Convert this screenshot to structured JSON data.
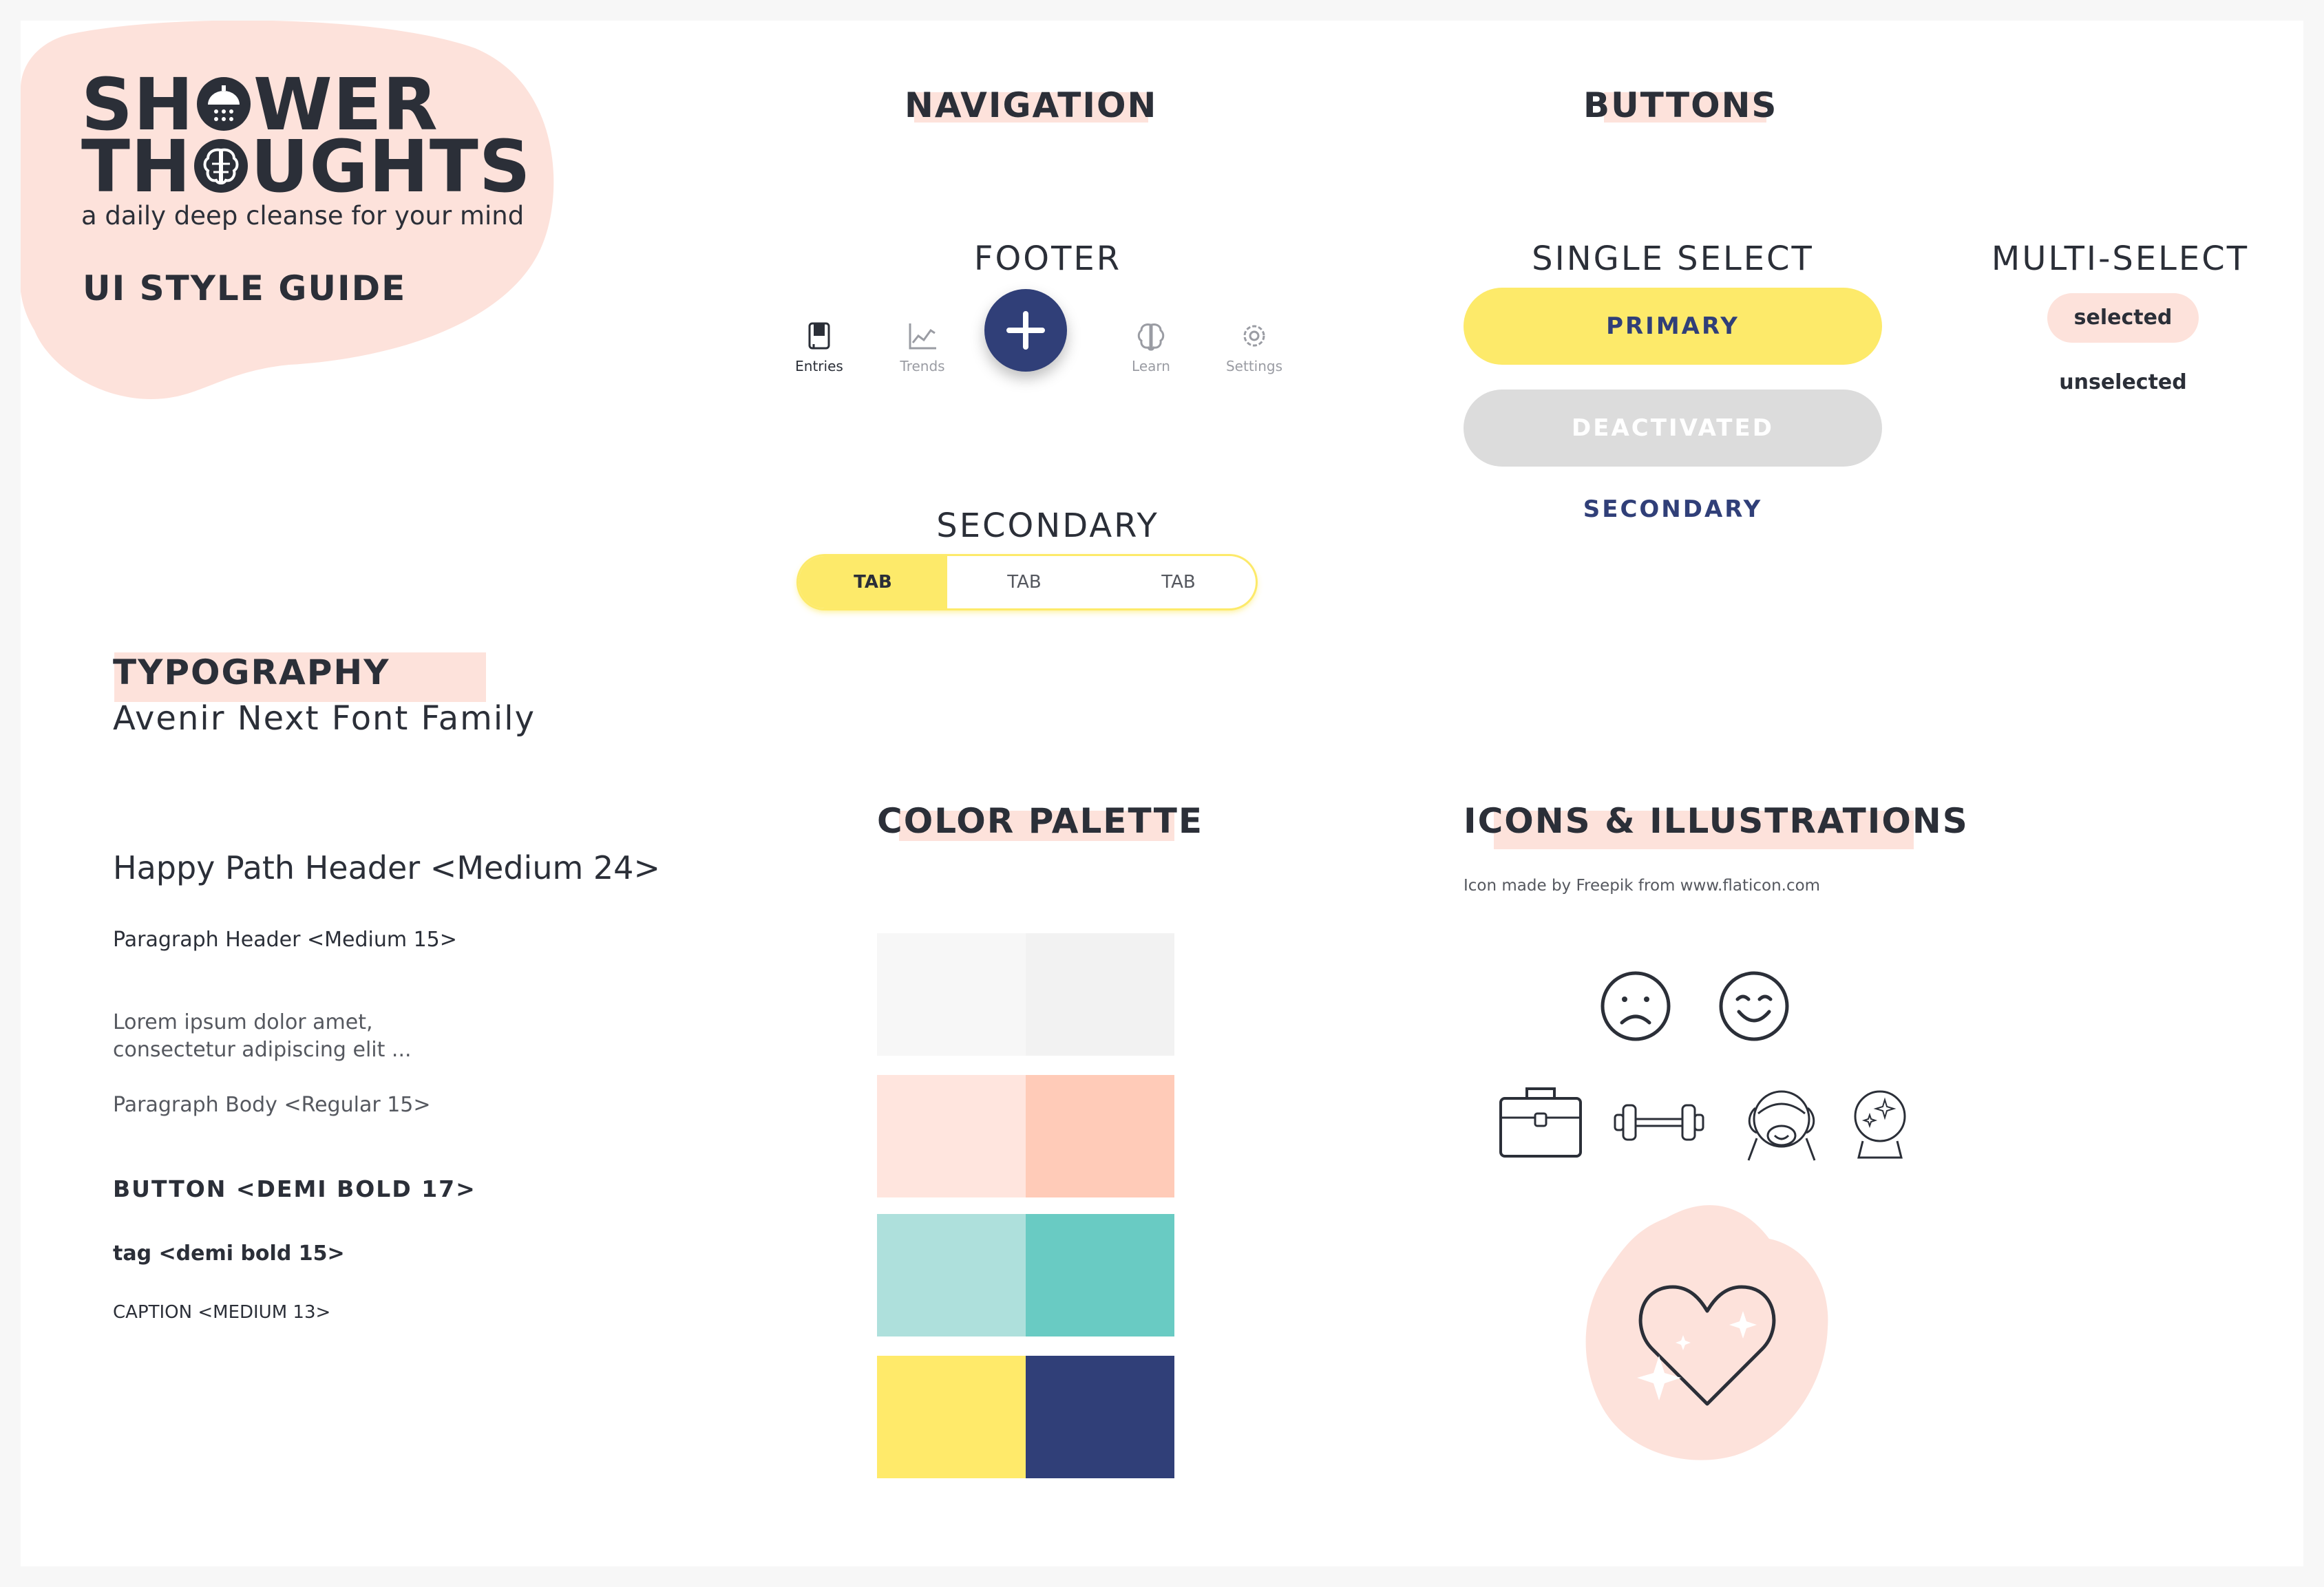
{
  "logo": {
    "line1": [
      "SH",
      "WER"
    ],
    "line2": [
      "TH",
      "UGHTS"
    ],
    "tagline": "a daily deep cleanse for your mind",
    "guide_title": "UI STYLE GUIDE",
    "blob_color": "#fde2db"
  },
  "navigation": {
    "heading": "NAVIGATION",
    "footer_heading": "FOOTER",
    "footer_items": [
      {
        "label": "Entries",
        "icon": "journal-icon",
        "active": true
      },
      {
        "label": "Trends",
        "icon": "trend-chart-icon",
        "active": false
      },
      {
        "label": "Learn",
        "icon": "brain-icon",
        "active": false
      },
      {
        "label": "Settings",
        "icon": "gear-icon",
        "active": false
      }
    ],
    "fab_icon": "plus-icon",
    "secondary_heading": "SECONDARY",
    "tabs": [
      {
        "label": "TAB",
        "active": true
      },
      {
        "label": "TAB",
        "active": false
      },
      {
        "label": "TAB",
        "active": false
      }
    ]
  },
  "buttons": {
    "heading": "BUTTONS",
    "single_select_heading": "SINGLE SELECT",
    "primary_label": "PRIMARY",
    "deactivated_label": "DEACTIVATED",
    "secondary_label": "SECONDARY",
    "multi_select_heading": "MULTI-SELECT",
    "selected_label": "selected",
    "unselected_label": "unselected"
  },
  "typography": {
    "heading": "TYPOGRAPHY",
    "font_family": "Avenir Next Font Family",
    "samples": {
      "header": "Happy Path Header <Medium 24>",
      "paragraph_header": "Paragraph Header <Medium 15>",
      "lorem_line1": "Lorem ipsum dolor amet,",
      "lorem_line2": "consectetur adipiscing elit ...",
      "paragraph_body": "Paragraph Body <Regular 15>",
      "button": "BUTTON <DEMI BOLD 17>",
      "tag": "tag <demi bold 15>",
      "caption": "CAPTION <MEDIUM 13>"
    }
  },
  "palette": {
    "heading": "COLOR PALETTE",
    "rows": [
      [
        "#f7f7f7",
        "#f2f2f2"
      ],
      [
        "#ffe5de",
        "#ffcbb8"
      ],
      [
        "#aee0dc",
        "#69cbc3"
      ],
      [
        "#ffea6a",
        "#303f78"
      ]
    ]
  },
  "icons": {
    "heading": "ICONS & ILLUSTRATIONS",
    "credit": "Icon made by Freepik from www.flaticon.com",
    "row1": [
      "sad-face-icon",
      "happy-face-icon"
    ],
    "row2": [
      "briefcase-icon",
      "dumbbell-icon",
      "monkey-icon",
      "crystal-ball-icon"
    ],
    "illustration": "heart-sparkle-icon"
  },
  "colors": {
    "accent_pink": "#fde2db",
    "accent_yellow": "#fdea6a",
    "navy": "#303f78",
    "text_dark": "#2b2f38",
    "grey": "#dcdcdc"
  }
}
